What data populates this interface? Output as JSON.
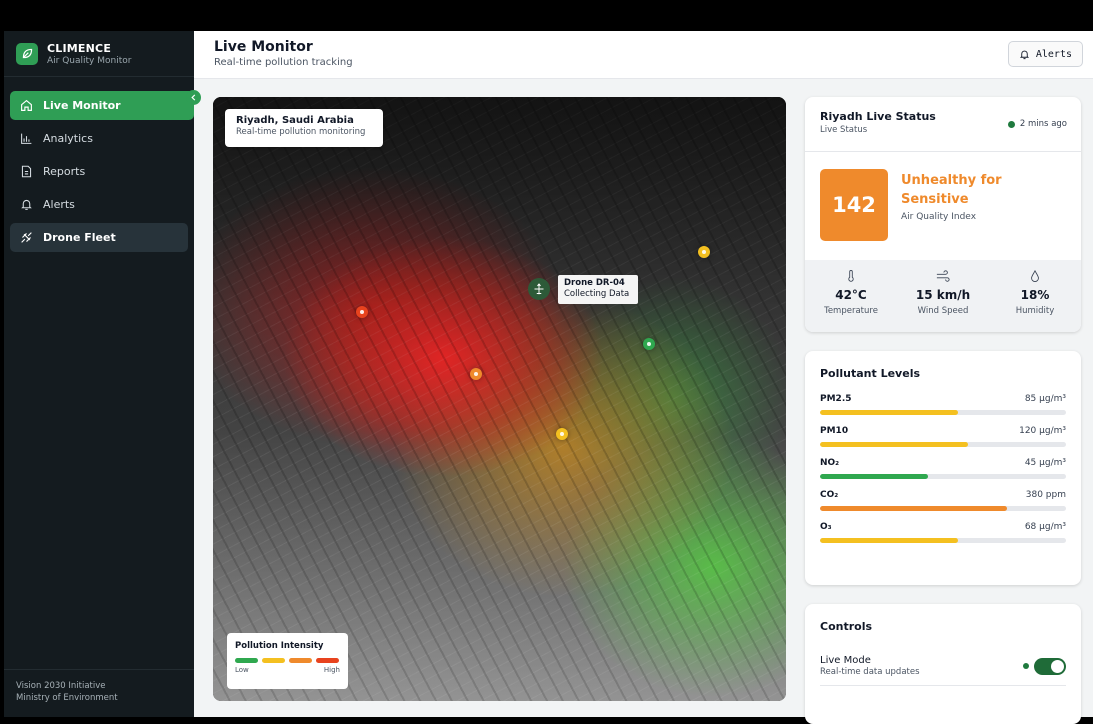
{
  "app": {
    "name": "CLIMENCE",
    "subtitle": "Air Quality Monitor"
  },
  "sidebar": {
    "items": [
      {
        "label": "Live Monitor",
        "icon": "home-icon",
        "active": true
      },
      {
        "label": "Analytics",
        "icon": "bar-chart-icon"
      },
      {
        "label": "Reports",
        "icon": "document-icon"
      },
      {
        "label": "Alerts",
        "icon": "bell-icon"
      },
      {
        "label": "Drone Fleet",
        "icon": "plane-icon",
        "highlighted": true
      }
    ],
    "footer_line1": "Vision 2030 Initiative",
    "footer_line2": "Ministry of Environment"
  },
  "header": {
    "title": "Live Monitor",
    "subtitle": "Real-time pollution tracking",
    "alerts_label": "Alerts"
  },
  "map": {
    "location_title": "Riyadh, Saudi Arabia",
    "location_sub": "Real-time pollution monitoring",
    "drone_name": "Drone DR-04",
    "drone_status": "Collecting Data",
    "legend": {
      "title": "Pollution Intensity",
      "low": "Low",
      "high": "High",
      "colors": [
        "#2fa84f",
        "#f4c020",
        "#ef8a2c",
        "#e8431e"
      ]
    },
    "marker_colors": {
      "red": "#e8431e",
      "orange": "#ef8a2c",
      "yellow": "#f4c020",
      "green": "#2fa84f"
    }
  },
  "status": {
    "title": "Riyadh Live Status",
    "sub": "Live Status",
    "updated": "2 mins ago",
    "aqi": "142",
    "category": "Unhealthy for Sensitive",
    "aqi_label": "Air Quality Index",
    "weather": [
      {
        "icon": "thermometer-icon",
        "value": "42°C",
        "label": "Temperature"
      },
      {
        "icon": "wind-icon",
        "value": "15 km/h",
        "label": "Wind Speed"
      },
      {
        "icon": "droplet-icon",
        "value": "18%",
        "label": "Humidity"
      }
    ]
  },
  "pollutants": {
    "title": "Pollutant Levels",
    "items": [
      {
        "name": "PM2.5",
        "value": "85 μg/m³",
        "fill": 0.56,
        "color": "#f4c020"
      },
      {
        "name": "PM10",
        "value": "120 μg/m³",
        "fill": 0.6,
        "color": "#f4c020"
      },
      {
        "name": "NO₂",
        "value": "45 μg/m³",
        "fill": 0.44,
        "color": "#2fa84f"
      },
      {
        "name": "CO₂",
        "value": "380 ppm",
        "fill": 0.76,
        "color": "#ef8a2c"
      },
      {
        "name": "O₃",
        "value": "68 μg/m³",
        "fill": 0.56,
        "color": "#f4c020"
      }
    ]
  },
  "controls": {
    "title": "Controls",
    "live_mode_label": "Live Mode",
    "live_mode_sub": "Real-time data updates",
    "live_mode_on": true
  }
}
